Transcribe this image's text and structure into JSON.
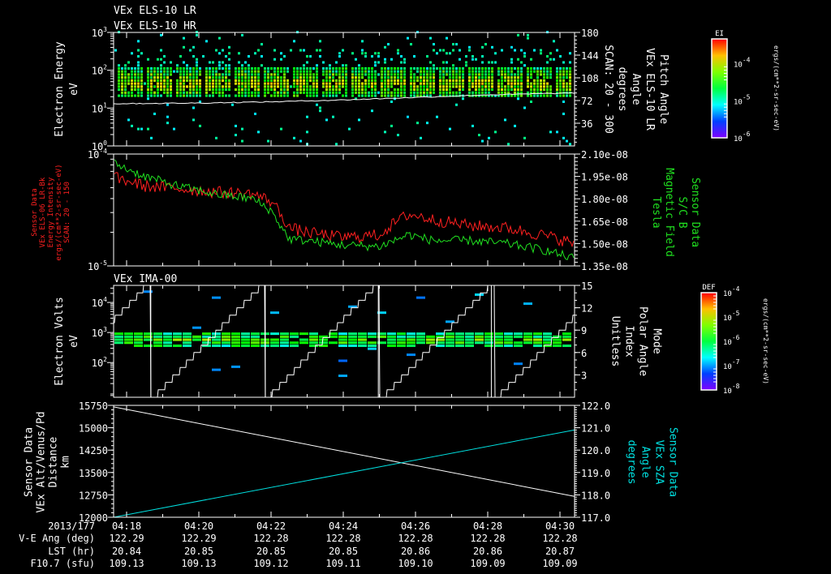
{
  "titles": {
    "els_lr": "VEx ELS-10 LR",
    "els_hr": "VEx ELS-10 HR",
    "ima": "VEx IMA-00"
  },
  "time_axis": {
    "row_labels": [
      "2013/177",
      "V-E Ang (deg)",
      "LST (hr)",
      "F10.7 (sfu)"
    ],
    "ticks": [
      "04:18",
      "04:20",
      "04:22",
      "04:24",
      "04:26",
      "04:28",
      "04:30"
    ],
    "tick_minutes": [
      0,
      2,
      4,
      6,
      8,
      10,
      12
    ],
    "ve_ang": [
      "122.29",
      "122.29",
      "122.28",
      "122.28",
      "122.28",
      "122.28",
      "122.28"
    ],
    "lst": [
      "20.84",
      "20.85",
      "20.85",
      "20.85",
      "20.86",
      "20.86",
      "20.87"
    ],
    "f107": [
      "109.13",
      "109.13",
      "109.12",
      "109.11",
      "109.10",
      "109.09",
      "109.09"
    ],
    "xlim_minutes": [
      -0.36,
      12.4
    ]
  },
  "chart_data": [
    {
      "type": "heatmap",
      "panel": "ELS electron spectrogram",
      "ylabel": [
        "Electron Energy",
        "eV"
      ],
      "yscale": "log",
      "ylim": [
        1,
        1000
      ],
      "yticks": [
        {
          "b": "10",
          "e": "3"
        },
        {
          "b": "10",
          "e": "2"
        },
        {
          "b": "10",
          "e": "1"
        },
        {
          "b": "10",
          "e": "0"
        }
      ],
      "ytick_values": [
        1000,
        100,
        10,
        1
      ],
      "y2label": [
        "Pitch Angle",
        "VEx ELS-10 LR",
        "Angle",
        "degrees",
        "SCAN: 20 - 300"
      ],
      "y2lim": [
        0,
        180
      ],
      "y2ticks": [
        "180",
        "144",
        "108",
        "72",
        "36"
      ],
      "y2tick_values": [
        180,
        144,
        108,
        72,
        36
      ],
      "band_energy_eV": [
        16,
        110
      ],
      "band_peak_eV": 40,
      "overlay_line_pitch_angle": {
        "minutes": [
          -0.36,
          2,
          4,
          6,
          8,
          10,
          12.4
        ],
        "values": [
          67,
          68,
          70,
          73,
          77,
          81,
          84
        ]
      },
      "colorbar": {
        "title": "EI",
        "labels": [
          {
            "b": "10",
            "e": "-4"
          },
          {
            "b": "10",
            "e": "-5"
          },
          {
            "b": "10",
            "e": "-6"
          }
        ],
        "units": "ergs/(cm**2-sr-sec-eV)"
      }
    },
    {
      "type": "line",
      "panel": "Energy intensity and magnetic field",
      "ylabel": [
        "Sensor Data",
        "VEx ELS-06 LR-Bk",
        "Energy Intensity",
        "ergs/(cm**2-sr-sec-eV)",
        "SCAN: 20 - 150"
      ],
      "yscale": "log",
      "ylim": [
        1e-05,
        0.0001
      ],
      "yticks": [
        {
          "b": "10",
          "e": "-4"
        },
        {
          "b": "10",
          "e": "-5"
        }
      ],
      "y2label": [
        "Sensor Data",
        "S/C B",
        "Magnetic Field",
        "Tesla"
      ],
      "y2lim": [
        1.35e-08,
        2.1e-08
      ],
      "y2ticks": [
        "2.10e-08",
        "1.95e-08",
        "1.80e-08",
        "1.65e-08",
        "1.50e-08",
        "1.35e-08"
      ],
      "series": [
        {
          "name": "Energy Intensity",
          "axis": "left",
          "color": "#ff2020",
          "minutes": [
            -0.36,
            0.5,
            1.5,
            2.5,
            3.5,
            4.0,
            4.5,
            5.0,
            6.0,
            7.0,
            7.8,
            8.5,
            9.5,
            10.5,
            11.5,
            12.4
          ],
          "values": [
            6.2e-05,
            5.2e-05,
            4.9e-05,
            4.6e-05,
            4.4e-05,
            3.8e-05,
            2.2e-05,
            2e-05,
            1.8e-05,
            1.9e-05,
            2.9e-05,
            2.6e-05,
            2.3e-05,
            2.2e-05,
            1.9e-05,
            1.6e-05
          ]
        },
        {
          "name": "S/C B Magnetic Field",
          "axis": "right",
          "color": "#20e020",
          "minutes": [
            -0.36,
            0.5,
            1.5,
            2.5,
            3.5,
            4.0,
            4.5,
            5.0,
            6.0,
            7.0,
            7.8,
            8.5,
            9.5,
            10.5,
            11.5,
            12.4
          ],
          "values": [
            2.04e-08,
            1.95e-08,
            1.88e-08,
            1.83e-08,
            1.8e-08,
            1.72e-08,
            1.53e-08,
            1.52e-08,
            1.49e-08,
            1.48e-08,
            1.56e-08,
            1.52e-08,
            1.52e-08,
            1.5e-08,
            1.46e-08,
            1.4e-08
          ]
        }
      ]
    },
    {
      "type": "heatmap",
      "panel": "IMA spectrogram",
      "ylabel": [
        "Electron Volts",
        "eV"
      ],
      "yscale": "log",
      "ylim": [
        7,
        37000
      ],
      "yticks": [
        {
          "b": "10",
          "e": "4"
        },
        {
          "b": "10",
          "e": "3"
        },
        {
          "b": "10",
          "e": "2"
        }
      ],
      "ytick_values": [
        10000,
        1000,
        100
      ],
      "y2label": [
        "Mode",
        "Polar Angle",
        "Index",
        "Unitless"
      ],
      "y2lim": [
        0,
        15
      ],
      "y2ticks": [
        "15",
        "12",
        "9",
        "6",
        "3"
      ],
      "y2tick_values": [
        15,
        12,
        9,
        6,
        3
      ],
      "band_energy_eV": [
        280,
        900
      ],
      "polar_angle_resets_minutes": [
        0.67,
        3.84,
        6.97,
        10.1
      ],
      "colorbar": {
        "title": "DEF",
        "labels": [
          {
            "b": "10",
            "e": "-4"
          },
          {
            "b": "10",
            "e": "-5"
          },
          {
            "b": "10",
            "e": "-6"
          },
          {
            "b": "10",
            "e": "-7"
          },
          {
            "b": "10",
            "e": "-8"
          }
        ],
        "units": "ergs/(cm**2-sr-sec-eV)"
      }
    },
    {
      "type": "line",
      "panel": "Altitude and SZA",
      "ylabel": [
        "Sensor Data",
        "VEx Alt/Venus/Pd",
        "Distance",
        "km"
      ],
      "ylim": [
        12000,
        15750
      ],
      "yticks": [
        "15750",
        "15000",
        "14250",
        "13500",
        "12750",
        "12000"
      ],
      "ytick_values": [
        15750,
        15000,
        14250,
        13500,
        12750,
        12000
      ],
      "y2label": [
        "Sensor Data",
        "VEx SZA",
        "Angle",
        "degrees"
      ],
      "y2lim": [
        117.0,
        122.0
      ],
      "y2ticks": [
        "122.0",
        "121.0",
        "120.0",
        "119.0",
        "118.0",
        "117.0"
      ],
      "y2tick_values": [
        122,
        121,
        120,
        119,
        118,
        117
      ],
      "series": [
        {
          "name": "Distance",
          "axis": "left",
          "color": "#ffffff",
          "minutes": [
            -0.36,
            12.4
          ],
          "values": [
            15700,
            12700
          ]
        },
        {
          "name": "SZA",
          "axis": "right",
          "color": "#00e0e0",
          "minutes": [
            -0.36,
            12.4
          ],
          "values": [
            117.0,
            120.9
          ]
        }
      ]
    }
  ]
}
